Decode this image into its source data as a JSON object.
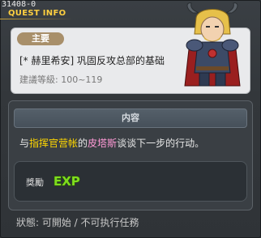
{
  "header": {
    "quest_id": "31408-0",
    "title": "QUEST INFO"
  },
  "quest": {
    "category": "主要",
    "name": "[* 赫里希安] 巩固反攻总部的基础",
    "level_requirement": "建議等級: 100~119"
  },
  "content": {
    "header_label": "内容",
    "text_prefix": "与",
    "npc_name": "指挥官营帐",
    "text_middle": "的",
    "map_name": "皮塔斯",
    "text_suffix": "谈谈下一步的行动。"
  },
  "reward": {
    "label": "獎勵",
    "exp_icon_text": "EXP"
  },
  "status": {
    "text": "狀態: 可開始 / 不可执行任務"
  },
  "colors": {
    "title": "#ffd040",
    "npc_highlight": "#ffd700",
    "map_highlight": "#ff9ad6",
    "exp": "#7fdc1e"
  },
  "icons": {
    "portrait": "horned-warrior-portrait",
    "exp": "exp-icon"
  }
}
